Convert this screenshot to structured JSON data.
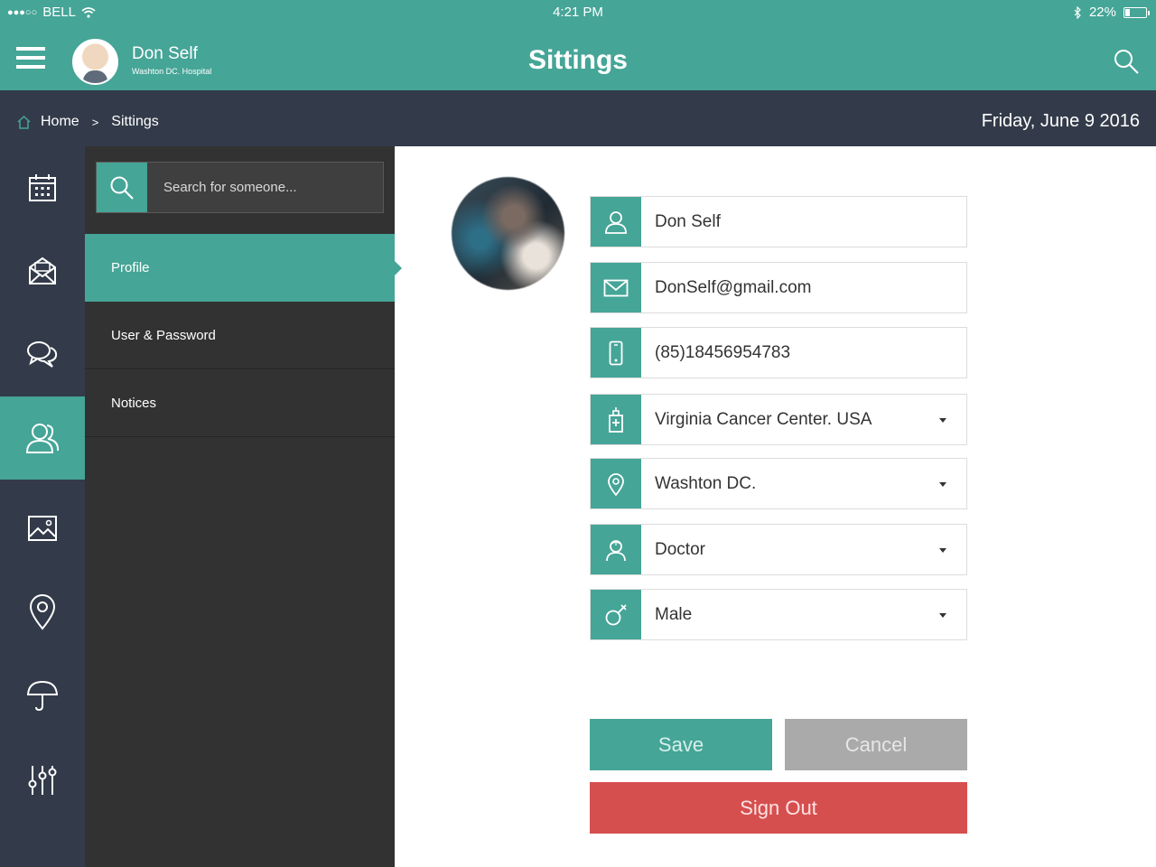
{
  "status_bar": {
    "signal": "●●●○○",
    "carrier": "BELL",
    "time": "4:21 PM",
    "battery": "22%",
    "battery_level": 0.22,
    "icons": [
      "wifi-icon",
      "bluetooth-icon",
      "battery-icon"
    ]
  },
  "header": {
    "user_name": "Don Self",
    "user_org": "Washton DC. Hospital",
    "title": "Sittings",
    "icons": [
      "menu-icon",
      "search-icon"
    ]
  },
  "breadcrumb": {
    "home": "Home",
    "separator": ">",
    "current": "Sittings",
    "date": "Friday, June 9 2016"
  },
  "rail": {
    "items": [
      "calendar-icon",
      "mail-icon",
      "chat-icon",
      "contacts-icon",
      "image-icon",
      "location-icon",
      "umbrella-icon",
      "sliders-icon"
    ],
    "active_index": 3
  },
  "submenu": {
    "search_placeholder": "Search for someone...",
    "items": [
      {
        "label": "Profile",
        "active": true
      },
      {
        "label": "User & Password",
        "active": false
      },
      {
        "label": "Notices",
        "active": false
      }
    ]
  },
  "profile": {
    "fields": [
      {
        "icon": "user-icon",
        "value": "Don Self",
        "dropdown": false
      },
      {
        "icon": "mail-icon",
        "value": "DonSelf@gmail.com",
        "dropdown": false
      },
      {
        "icon": "phone-icon",
        "value": "(85)18456954783",
        "dropdown": false
      },
      {
        "icon": "hospital-icon",
        "value": "Virginia Cancer Center. USA",
        "dropdown": true
      },
      {
        "icon": "location-icon",
        "value": "Washton DC.",
        "dropdown": true
      },
      {
        "icon": "doctor-icon",
        "value": "Doctor",
        "dropdown": true
      },
      {
        "icon": "male-icon",
        "value": "Male",
        "dropdown": true
      }
    ]
  },
  "actions": {
    "save": "Save",
    "cancel": "Cancel",
    "sign_out": "Sign Out"
  },
  "colors": {
    "accent": "#45a597",
    "dark_bar": "#333b4a",
    "submenu_bg": "#323232",
    "danger": "#d64f4f",
    "muted": "#aaaaaa"
  }
}
